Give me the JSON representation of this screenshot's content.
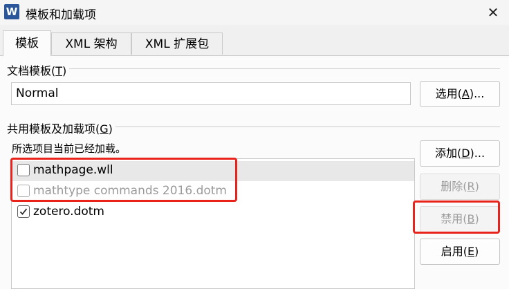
{
  "window": {
    "app_icon_letter": "W",
    "title": "模板和加载项",
    "close_glyph": "✕"
  },
  "tabs": [
    {
      "label": "模板",
      "active": true
    },
    {
      "label": "XML 架构",
      "active": false
    },
    {
      "label": "XML 扩展包",
      "active": false
    }
  ],
  "document_template": {
    "group_label_main": "文档模板(",
    "group_label_key": "T",
    "group_label_end": ")",
    "value": "Normal",
    "select_button": {
      "main": "选用(",
      "key": "A",
      "end": ")..."
    }
  },
  "global_templates": {
    "group_label_main": "共用模板及加载项(",
    "group_label_key": "G",
    "group_label_end": ")",
    "hint": "所选项目当前已经加载。",
    "items": [
      {
        "label": "mathpage.wll",
        "checked": false,
        "dimmed": false,
        "selected": true
      },
      {
        "label": "mathtype commands 2016.dotm",
        "checked": false,
        "dimmed": true,
        "selected": false
      },
      {
        "label": "zotero.dotm",
        "checked": true,
        "dimmed": false,
        "selected": false
      }
    ],
    "buttons": {
      "add": {
        "main": "添加(",
        "key": "D",
        "end": ")...",
        "enabled": true
      },
      "remove": {
        "main": "删除(",
        "key": "R",
        "end": ")",
        "enabled": false
      },
      "disable": {
        "main": "禁用(",
        "key": "B",
        "end": ")",
        "enabled": false
      },
      "enable": {
        "main": "启用(",
        "key": "E",
        "end": ")",
        "enabled": true
      }
    }
  },
  "colors": {
    "annotation_red": "#e8231c",
    "word_blue": "#2b579a"
  }
}
